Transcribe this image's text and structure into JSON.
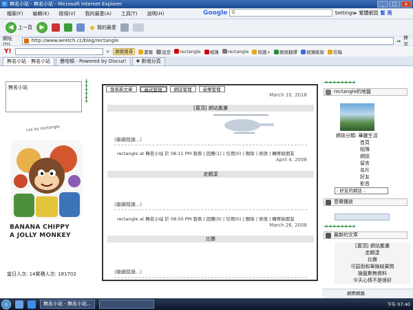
{
  "window": {
    "title": "無名小站 - 無名小站 - Microsoft Internet Explorer",
    "minimize": "_",
    "maximize": "□",
    "close": "x"
  },
  "menu": [
    "檔案(F)",
    "編輯(E)",
    "檢視(V)",
    "我的最愛(A)",
    "工具(T)",
    "說明(H)"
  ],
  "google": {
    "logo": "Google",
    "field": "G",
    "settings": "Settings▸",
    "wrap": "繁體網頁",
    "trad": "繁",
    "simp": "简"
  },
  "toolbar": {
    "back": "上一頁",
    "favorites": "我的最愛"
  },
  "address": {
    "label": "網址(D)",
    "url": "http://www.wretch.cc/blog/rectangle",
    "go": "移至"
  },
  "yahoo": {
    "logo": "Y!",
    "search_btn": "網頁搜尋",
    "links": [
      "書籤",
      "設定",
      "rectangle",
      "相簿",
      "rectangle",
      "知識+",
      "網頁翻譯",
      "相簿跳窗",
      "信箱"
    ]
  },
  "tabs": [
    {
      "label": "無名小站 - 無名小站"
    },
    {
      "label": "曼哈頓 - Powered by Discuz!"
    },
    {
      "label": "新增分頁"
    }
  ],
  "left": {
    "search_box_label": "無名小站",
    "css_by": "css by rectangle",
    "banana1": "BANANA CHIPPY",
    "banana2": "A JOLLY MONKEY",
    "counter": "當日人次: 14累積人次: 181702"
  },
  "panel": {
    "tabs": [
      "發表新文章",
      "格式管理",
      "網誌管理",
      "音樂管理"
    ],
    "posts": [
      {
        "date": "March 10, 2018",
        "title": "[置頂] 網站搬遷",
        "more": "(繼續閱讀...)",
        "meta": "rectangle at 無名小站 於 08:11 PM 發表 | 回應(1) | 引用(0) | 刪除 | 修改 | 轉寄給朋友"
      },
      {
        "date": "April 4, 2008",
        "title": "走鋼漾",
        "more": "(繼續閱讀...)",
        "meta": "rectangle at 無名小站 於 08:50 PM 發表 | 回應(0) | 引用(0) | 刪除 | 修改 | 轉寄給朋友"
      },
      {
        "date": "March 26, 2008",
        "title": "比賽",
        "more": "(繼續閱讀...)"
      }
    ]
  },
  "right": {
    "profile_head": "rectangle的地盤",
    "category_label": "網誌分類: 華麗生活",
    "links": [
      "首頁",
      "相簿",
      "網誌",
      "留言",
      "名片",
      "好友",
      "影音"
    ],
    "fav_select": "- 好友的網誌 -",
    "music_head": "音樂播放",
    "articles_head": "最新的文章",
    "articles": [
      "[置頂] 網站搬遷",
      "走鋼漾",
      "比賽",
      "可惡而和筆錄結果問",
      "論盤數無資料",
      "今天心情不是很好"
    ]
  },
  "status": {
    "zone": "網際網路"
  },
  "taskbar": {
    "task1": "無名小站 - 無名小站...",
    "task2": "",
    "clock": "下午 07:40"
  },
  "colors": {
    "accent": "#2b8a3e",
    "titlebar": "#1d4a8f"
  }
}
